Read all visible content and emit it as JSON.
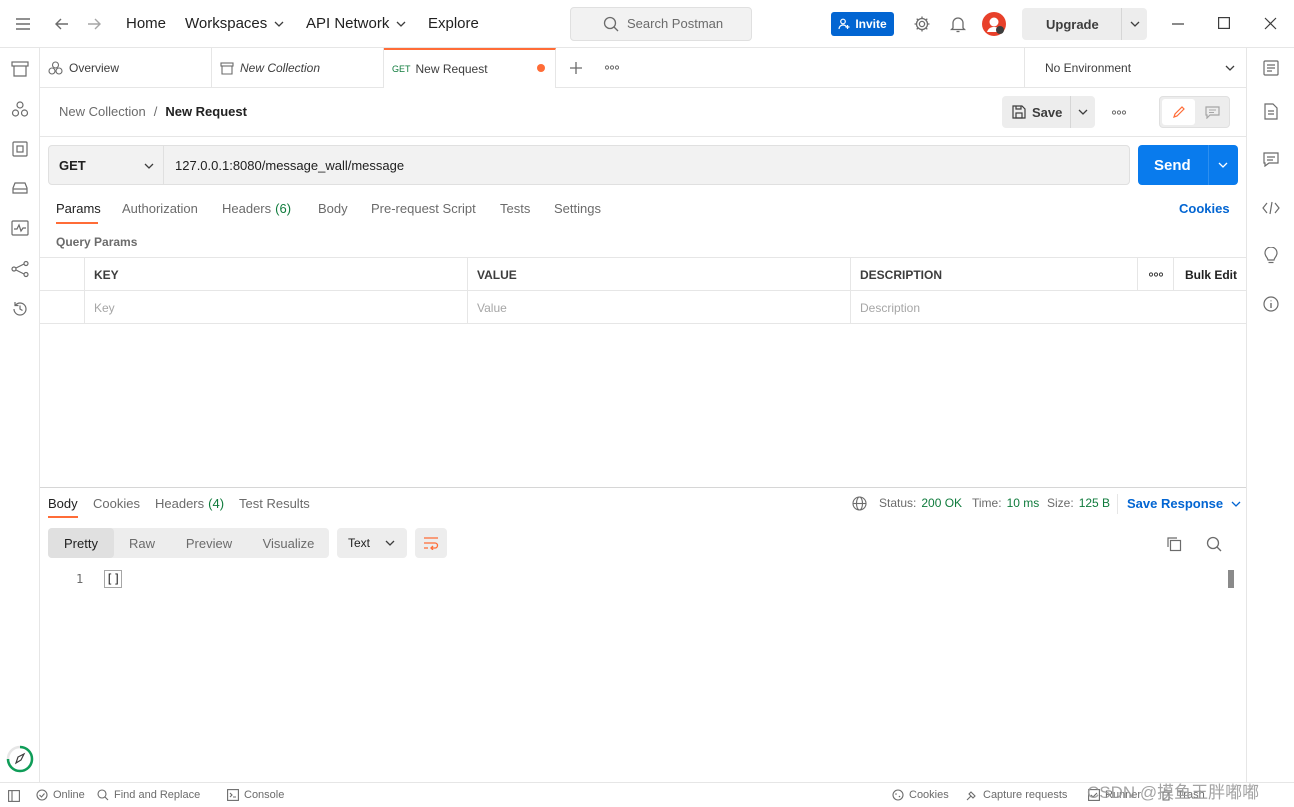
{
  "topbar": {
    "home": "Home",
    "workspaces": "Workspaces",
    "api_network": "API Network",
    "explore": "Explore",
    "search_placeholder": "Search Postman",
    "invite": "Invite",
    "upgrade": "Upgrade"
  },
  "tabs": [
    {
      "label": "Overview"
    },
    {
      "label": "New Collection"
    },
    {
      "method": "GET",
      "label": "New Request"
    }
  ],
  "environment": "No Environment",
  "breadcrumb": {
    "parent": "New Collection",
    "separator": "/",
    "current": "New Request"
  },
  "toolbar": {
    "save": "Save"
  },
  "request": {
    "method": "GET",
    "url": "127.0.0.1:8080/message_wall/message",
    "send": "Send"
  },
  "request_tabs": [
    {
      "label": "Params"
    },
    {
      "label": "Authorization"
    },
    {
      "label": "Headers",
      "count": "(6)"
    },
    {
      "label": "Body"
    },
    {
      "label": "Pre-request Script"
    },
    {
      "label": "Tests"
    },
    {
      "label": "Settings"
    }
  ],
  "cookies_link": "Cookies",
  "query_params": {
    "title": "Query Params",
    "headers": {
      "key": "KEY",
      "value": "VALUE",
      "description": "DESCRIPTION",
      "bulk_edit": "Bulk Edit"
    },
    "placeholders": {
      "key": "Key",
      "value": "Value",
      "description": "Description"
    }
  },
  "response": {
    "tabs": [
      {
        "label": "Body"
      },
      {
        "label": "Cookies"
      },
      {
        "label": "Headers",
        "count": "(4)"
      },
      {
        "label": "Test Results"
      }
    ],
    "status_label": "Status:",
    "status_value": "200 OK",
    "time_label": "Time:",
    "time_value": "10 ms",
    "size_label": "Size:",
    "size_value": "125 B",
    "save_response": "Save Response",
    "formats": [
      "Pretty",
      "Raw",
      "Preview",
      "Visualize"
    ],
    "language": "Text",
    "line_number": "1",
    "body_text": "[]"
  },
  "statusbar": {
    "online": "Online",
    "find_replace": "Find and Replace",
    "console": "Console",
    "cookies": "Cookies",
    "capture": "Capture requests",
    "runner": "Runner",
    "trash": "Trash",
    "watermark": "CSDN @摸鱼王胖嘟嘟"
  },
  "colors": {
    "accent": "#ff6c37",
    "send": "#097bed",
    "invite": "#0265d2",
    "success": "#0f7b3c"
  }
}
